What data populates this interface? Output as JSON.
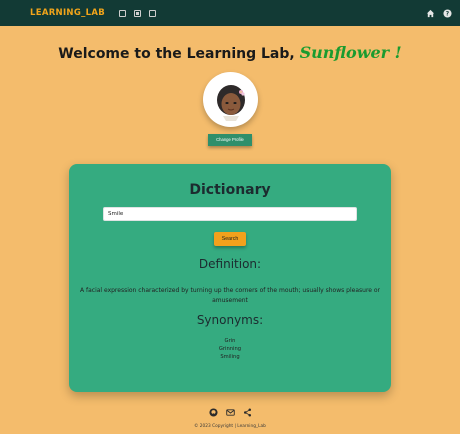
{
  "navbar": {
    "brand": "LEARNING_LAB",
    "icons": [
      "grid-icon",
      "badge-a-icon",
      "table-icon",
      "home-icon",
      "help-icon"
    ]
  },
  "welcome": {
    "prefix": "Welcome to the Learning Lab, ",
    "username": "Sunflower !"
  },
  "profile": {
    "change_label": "Change Profile"
  },
  "dictionary": {
    "title": "Dictionary",
    "search_value": "Smile",
    "search_label": "Search",
    "definition_heading": "Definition:",
    "definition_text": "A facial expression characterized by turning up the corners of the mouth; usually shows pleasure or amusement",
    "synonyms_heading": "Synonyms:",
    "synonyms": [
      "Grin",
      "Grinning",
      "Smiling"
    ]
  },
  "footer": {
    "icons": [
      "github-icon",
      "mail-icon",
      "share-icon"
    ],
    "copyright": "© 2023 Copyright | Learning_Lab"
  },
  "colors": {
    "background": "#f4bc6c",
    "navbar": "#123a35",
    "brand": "#f2a51a",
    "card": "#35ab80",
    "username": "#1a9b2f",
    "search_button": "#f2a11c",
    "change_button": "#2f8f6b"
  }
}
